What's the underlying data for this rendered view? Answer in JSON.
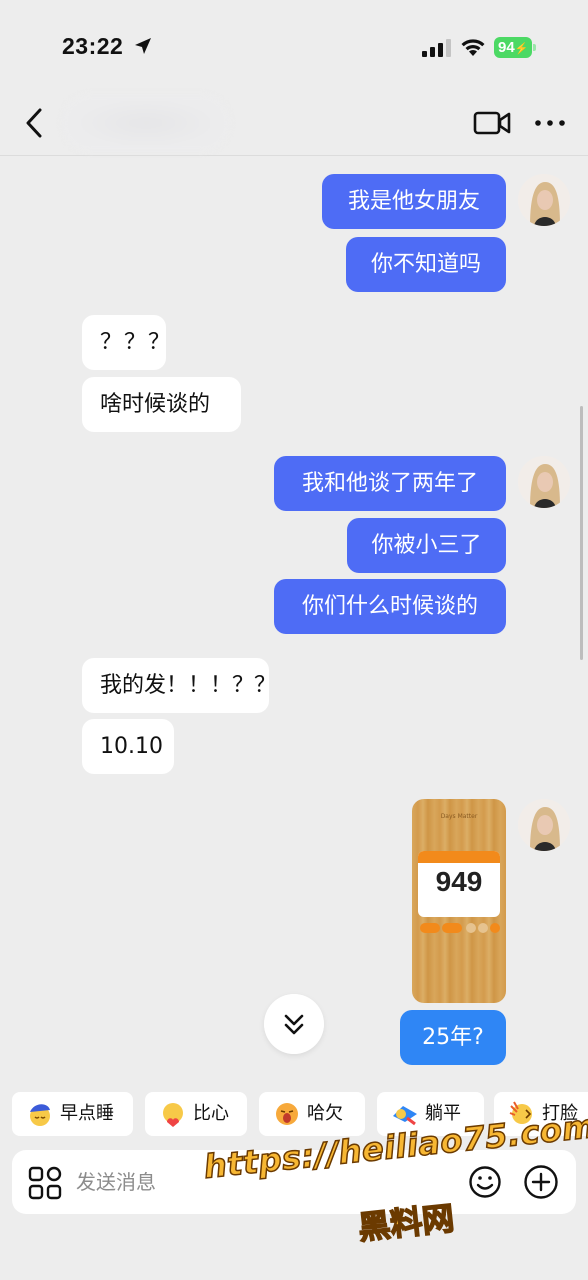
{
  "status_bar": {
    "time": "23:22",
    "battery": "94"
  },
  "header": {
    "icons": [
      "back-icon",
      "video-call-icon",
      "more-icon"
    ]
  },
  "messages": [
    {
      "side": "out",
      "text": "我是他女朋友"
    },
    {
      "side": "out",
      "text": "你不知道吗"
    },
    {
      "side": "in",
      "text": "？？？"
    },
    {
      "side": "in",
      "text": "啥时候谈的"
    },
    {
      "side": "out",
      "text": "我和他谈了两年了"
    },
    {
      "side": "out",
      "text": "你被小三了"
    },
    {
      "side": "out",
      "text": "你们什么时候谈的"
    },
    {
      "side": "in",
      "text": "我的发！！！？？"
    },
    {
      "side": "in",
      "text": "10.10"
    },
    {
      "side": "out",
      "type": "image",
      "number": "949"
    },
    {
      "side": "out",
      "text": "25年?"
    }
  ],
  "image_card": {
    "app_name": "Days Matter",
    "number": "949"
  },
  "quick_replies": [
    {
      "emoji": "sleep-emoji",
      "label": "早点睡"
    },
    {
      "emoji": "heart-hands-emoji",
      "label": "比心"
    },
    {
      "emoji": "yawn-emoji",
      "label": "哈欠"
    },
    {
      "emoji": "lie-flat-emoji",
      "label": "躺平"
    },
    {
      "emoji": "slap-emoji",
      "label": "打脸"
    }
  ],
  "input": {
    "placeholder": "发送消息"
  },
  "watermark": {
    "url": "https://heiliao75.com",
    "name": "黑料网"
  },
  "colors": {
    "outgoing_bubble": "#4e6cf5",
    "outgoing_bubble_alt": "#2f86f5",
    "incoming_bubble": "#ffffff",
    "background": "#ededed",
    "battery": "#4cd964",
    "watermark": "#f7b733"
  }
}
